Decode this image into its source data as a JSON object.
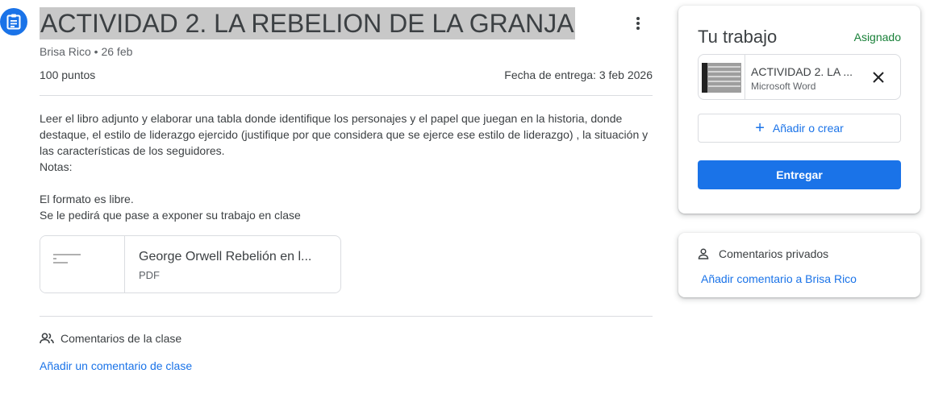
{
  "assignment": {
    "icon": "assignment-icon",
    "title": "ACTIVIDAD 2. LA REBELION DE LA GRANJA",
    "meta": "Brisa Rico • 26 feb",
    "points": "100 puntos",
    "due": "Fecha de entrega: 3 feb 2026",
    "description": "Leer el libro adjunto y elaborar una tabla donde identifique los personajes y el papel que juegan en la historia, donde destaque, el estilo de liderazgo ejercido (justifique por que considera que se ejerce ese estilo de liderazgo) , la situación y las características de los seguidores.\nNotas:\n\nEl formato es libre.\nSe le pedirá que pase a exponer su trabajo en clase",
    "attachment": {
      "name": "George Orwell Rebelión en l...",
      "type": "PDF"
    },
    "class_comments": {
      "label": "Comentarios de la clase",
      "add_link": "Añadir un comentario de clase"
    }
  },
  "your_work": {
    "title": "Tu trabajo",
    "status": "Asignado",
    "status_color": "#188038",
    "file": {
      "name": "ACTIVIDAD 2. LA ...",
      "type": "Microsoft Word"
    },
    "add_or_create": "Añadir o crear",
    "submit": "Entregar",
    "accent": "#1a73e8"
  },
  "private_comments": {
    "label": "Comentarios privados",
    "add_link": "Añadir comentario a Brisa Rico"
  }
}
